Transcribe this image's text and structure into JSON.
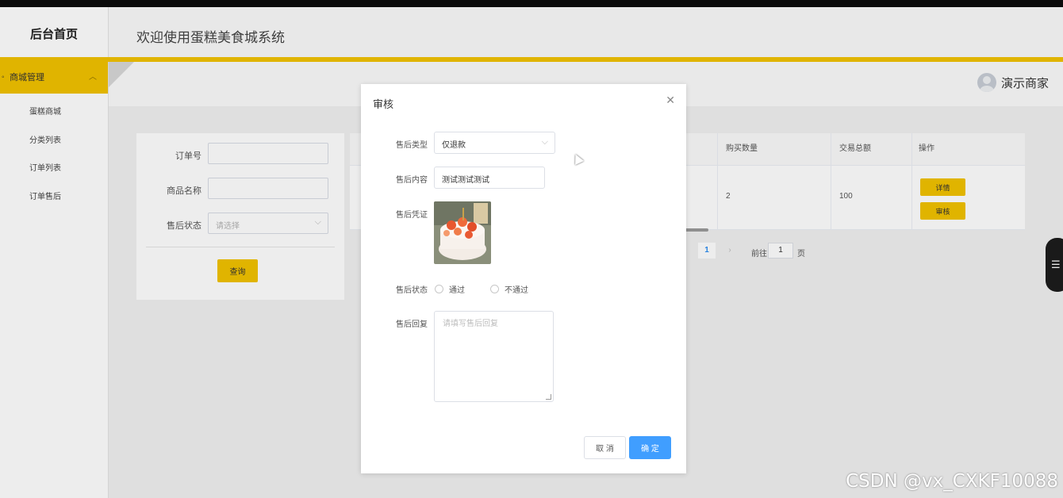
{
  "sidebar": {
    "brand": "后台首页",
    "group": {
      "label": "商城管理"
    },
    "items": [
      {
        "label": "蛋糕商城"
      },
      {
        "label": "分类列表"
      },
      {
        "label": "订单列表"
      },
      {
        "label": "订单售后"
      }
    ]
  },
  "header": {
    "title": "欢迎使用蛋糕美食城系统",
    "user": "演示商家"
  },
  "search": {
    "order_no_label": "订单号",
    "product_name_label": "商品名称",
    "status_label": "售后状态",
    "status_placeholder": "请选择",
    "query_button": "查询"
  },
  "table": {
    "headers": [
      "购买数量",
      "交易总额",
      "操作"
    ],
    "rows": [
      {
        "quantity": "2",
        "total": "100",
        "detail_button": "详情",
        "review_button": "审核"
      }
    ]
  },
  "pagination": {
    "current_page": "1",
    "goto_prefix": "前往",
    "goto_value": "1",
    "goto_suffix": "页"
  },
  "dialog": {
    "title": "审核",
    "type_label": "售后类型",
    "type_value": "仅退款",
    "content_label": "售后内容",
    "content_value": "测试测试测试",
    "proof_label": "售后凭证",
    "status_label": "售后状态",
    "status_options": [
      "通过",
      "不通过"
    ],
    "reply_label": "售后回复",
    "reply_placeholder": "请填写售后回复",
    "cancel_button": "取 消",
    "ok_button": "确 定"
  },
  "watermark": "CSDN @vx_CXKF10088",
  "colors": {
    "accent_yellow": "#f2c200",
    "primary_blue": "#409eff"
  }
}
